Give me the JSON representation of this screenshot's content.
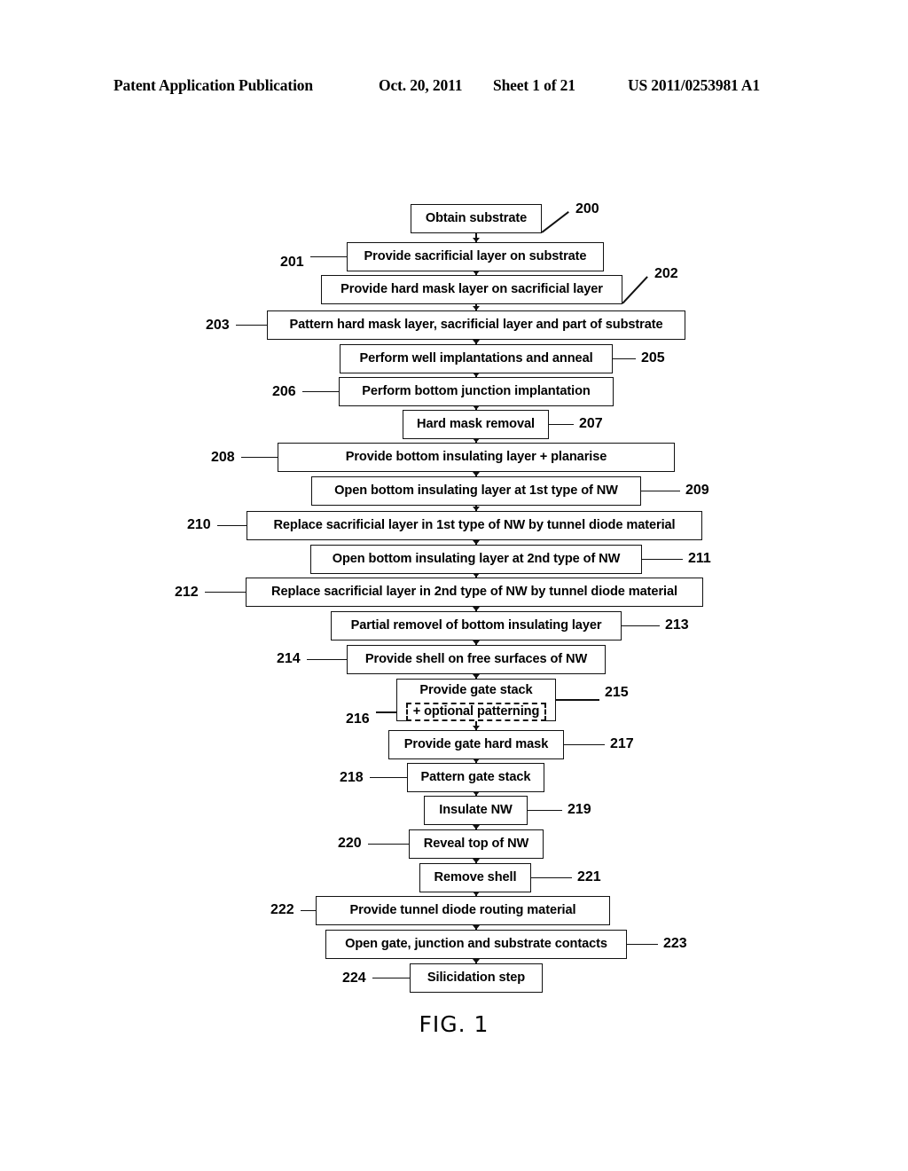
{
  "header": {
    "publication": "Patent Application Publication",
    "date": "Oct. 20, 2011",
    "sheet": "Sheet 1 of 21",
    "patent_number": "US 2011/0253981 A1"
  },
  "figure": {
    "caption": "FIG. 1",
    "type": "process-flowchart"
  },
  "flowchart": {
    "steps": [
      {
        "ref": "200",
        "label": "Obtain substrate",
        "ref_side": "right"
      },
      {
        "ref": "201",
        "label": "Provide sacrificial layer on substrate",
        "ref_side": "left"
      },
      {
        "ref": "202",
        "label": "Provide hard mask layer on sacrificial layer",
        "ref_side": "right"
      },
      {
        "ref": "203",
        "label": "Pattern hard mask layer, sacrificial layer and part of substrate",
        "ref_side": "left"
      },
      {
        "ref": "205",
        "label": "Perform well implantations and anneal",
        "ref_side": "right"
      },
      {
        "ref": "206",
        "label": "Perform bottom junction implantation",
        "ref_side": "left"
      },
      {
        "ref": "207",
        "label": "Hard mask removal",
        "ref_side": "right"
      },
      {
        "ref": "208",
        "label": "Provide bottom insulating layer + planarise",
        "ref_side": "left"
      },
      {
        "ref": "209",
        "label": "Open bottom insulating layer at 1st type of NW",
        "ref_side": "right"
      },
      {
        "ref": "210",
        "label": "Replace sacrificial layer in 1st type of NW by tunnel diode material",
        "ref_side": "left"
      },
      {
        "ref": "211",
        "label": "Open bottom insulating layer at 2nd type of NW",
        "ref_side": "right"
      },
      {
        "ref": "212",
        "label": "Replace sacrificial layer in 2nd type of NW by tunnel diode material",
        "ref_side": "left"
      },
      {
        "ref": "213",
        "label": "Partial removel of bottom insulating layer",
        "ref_side": "right"
      },
      {
        "ref": "214",
        "label": "Provide shell on free surfaces of NW",
        "ref_side": "left"
      },
      {
        "ref": "215",
        "label": "Provide gate stack",
        "ref_side": "right",
        "sub_ref": "216",
        "sub_label": "+ optional patterning"
      },
      {
        "ref": "217",
        "label": "Provide gate hard mask",
        "ref_side": "right"
      },
      {
        "ref": "218",
        "label": "Pattern gate stack",
        "ref_side": "left"
      },
      {
        "ref": "219",
        "label": "Insulate NW",
        "ref_side": "right"
      },
      {
        "ref": "220",
        "label": "Reveal top of NW",
        "ref_side": "left"
      },
      {
        "ref": "221",
        "label": "Remove shell",
        "ref_side": "right"
      },
      {
        "ref": "222",
        "label": "Provide tunnel diode routing material",
        "ref_side": "left"
      },
      {
        "ref": "223",
        "label": "Open gate, junction and substrate contacts",
        "ref_side": "right"
      },
      {
        "ref": "224",
        "label": "Silicidation step",
        "ref_side": "left"
      }
    ]
  }
}
